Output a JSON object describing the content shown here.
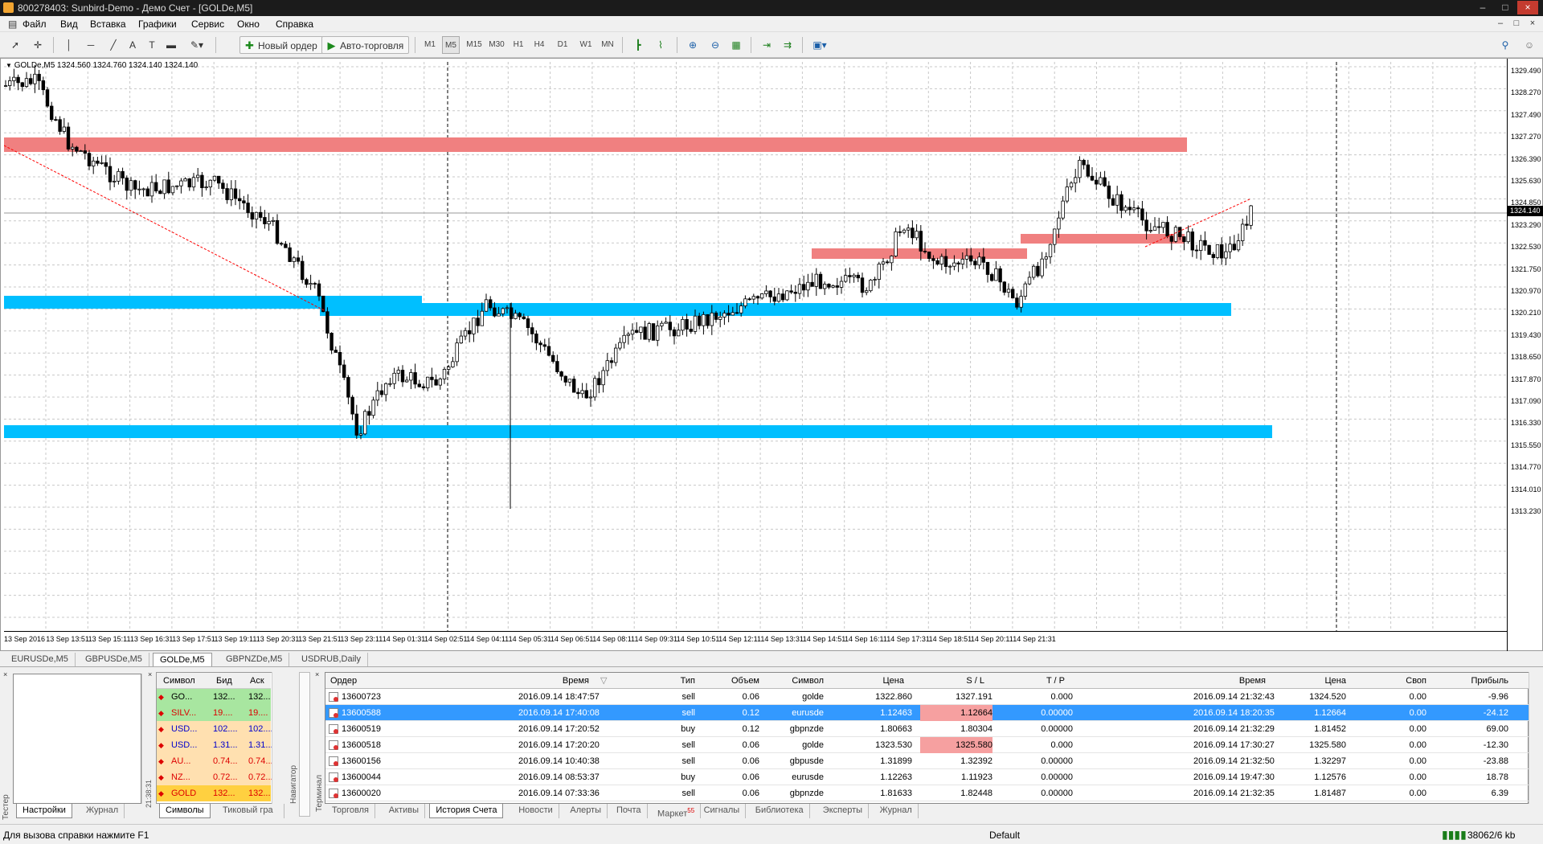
{
  "window": {
    "title": "800278403: Sunbird-Demo - Демо Счет - [GOLDe,M5]",
    "minimize": "–",
    "maximize": "□",
    "close": "×"
  },
  "menu": {
    "items": [
      "Файл",
      "Вид",
      "Вставка",
      "Графики",
      "Сервис",
      "Окно",
      "Справка"
    ],
    "mdi": [
      "–",
      "□",
      "×"
    ]
  },
  "toolbar": {
    "new_order": "Новый ордер",
    "auto_trading": "Авто-торговля",
    "timeframes": [
      "M1",
      "M5",
      "M15",
      "M30",
      "H1",
      "H4",
      "D1",
      "W1",
      "MN"
    ]
  },
  "chart": {
    "info": "GOLDe,M5  1324.560 1324.760 1324.140 1324.140",
    "current_price": "1324.140",
    "y_labels": [
      "1329.490",
      "1328.270",
      "1327.490",
      "1327.270",
      "1326.390",
      "1325.630",
      "1324.850",
      "1324.140",
      "1323.290",
      "1322.530",
      "1321.750",
      "1320.970",
      "1320.210",
      "1319.430",
      "1318.650",
      "1317.870",
      "1317.090",
      "1316.330",
      "1315.550",
      "1314.770",
      "1314.010",
      "1313.230"
    ],
    "x_labels": [
      "13 Sep 2016",
      "13 Sep 13:51",
      "13 Sep 15:11",
      "13 Sep 16:31",
      "13 Sep 17:51",
      "13 Sep 19:11",
      "13 Sep 20:31",
      "13 Sep 21:51",
      "13 Sep 23:11",
      "14 Sep 01:31",
      "14 Sep 02:51",
      "14 Sep 04:11",
      "14 Sep 05:31",
      "14 Sep 06:51",
      "14 Sep 08:11",
      "14 Sep 09:31",
      "14 Sep 10:51",
      "14 Sep 12:11",
      "14 Sep 13:31",
      "14 Sep 14:51",
      "14 Sep 16:11",
      "14 Sep 17:31",
      "14 Sep 18:51",
      "14 Sep 20:11",
      "14 Sep 21:31"
    ],
    "colors": {
      "resistance": "#f08080",
      "support": "#00bfff",
      "candles": "#000000",
      "trendline": "#ff0000"
    }
  },
  "chart_tabs": [
    "EURUSDe,M5",
    "GBPUSDe,M5",
    "GOLDe,M5",
    "GBPNZDe,M5",
    "USDRUB,Daily"
  ],
  "tester": {
    "label": "Тестер",
    "tabs": [
      "Настройки",
      "Журнал"
    ],
    "close": "×"
  },
  "market_watch": {
    "time": "21:38:31",
    "headers": [
      "Символ",
      "Бид",
      "Аск"
    ],
    "rows": [
      {
        "sym": "GO...",
        "bid": "132...",
        "ask": "132...",
        "color": "#a8e6a0",
        "fg": "#000"
      },
      {
        "sym": "SILV...",
        "bid": "19....",
        "ask": "19....",
        "color": "#a8e6a0",
        "fg": "#d00"
      },
      {
        "sym": "USD...",
        "bid": "102....",
        "ask": "102....",
        "color": "#ffe0b0",
        "fg": "#00c"
      },
      {
        "sym": "USD...",
        "bid": "1.31...",
        "ask": "1.31...",
        "color": "#ffe0b0",
        "fg": "#00c"
      },
      {
        "sym": "AU...",
        "bid": "0.74...",
        "ask": "0.74...",
        "color": "#ffe0b0",
        "fg": "#d00"
      },
      {
        "sym": "NZ...",
        "bid": "0.72...",
        "ask": "0.72...",
        "color": "#ffe0b0",
        "fg": "#d00"
      },
      {
        "sym": "GOLD",
        "bid": "132...",
        "ask": "132...",
        "color": "#ffd040",
        "fg": "#d00"
      }
    ],
    "tabs": [
      "Символы",
      "Тиковый гра"
    ],
    "close": "×"
  },
  "navigator": {
    "label": "Навигатор"
  },
  "terminal": {
    "label": "Терминал",
    "close": "×",
    "headers": [
      "Ордер",
      "Время",
      "Тип",
      "Объем",
      "Символ",
      "Цена",
      "S / L",
      "T / P",
      "Время",
      "Цена",
      "Своп",
      "Прибыль"
    ],
    "sort_mark": "▽",
    "rows": [
      {
        "order": "13600723",
        "time": "2016.09.14 18:47:57",
        "type": "sell",
        "vol": "0.06",
        "sym": "golde",
        "price": "1322.860",
        "sl": "1327.191",
        "tp": "0.000",
        "time2": "2016.09.14 21:32:43",
        "price2": "1324.520",
        "swap": "0.00",
        "profit": "-9.96",
        "sl_hit": false
      },
      {
        "order": "13600588",
        "time": "2016.09.14 17:40:08",
        "type": "sell",
        "vol": "0.12",
        "sym": "eurusde",
        "price": "1.12463",
        "sl": "1.12664",
        "tp": "0.00000",
        "time2": "2016.09.14 18:20:35",
        "price2": "1.12664",
        "swap": "0.00",
        "profit": "-24.12",
        "sl_hit": true
      },
      {
        "order": "13600519",
        "time": "2016.09.14 17:20:52",
        "type": "buy",
        "vol": "0.12",
        "sym": "gbpnzde",
        "price": "1.80663",
        "sl": "1.80304",
        "tp": "0.00000",
        "time2": "2016.09.14 21:32:29",
        "price2": "1.81452",
        "swap": "0.00",
        "profit": "69.00",
        "sl_hit": false
      },
      {
        "order": "13600518",
        "time": "2016.09.14 17:20:20",
        "type": "sell",
        "vol": "0.06",
        "sym": "golde",
        "price": "1323.530",
        "sl": "1325.580",
        "tp": "0.000",
        "time2": "2016.09.14 17:30:27",
        "price2": "1325.580",
        "swap": "0.00",
        "profit": "-12.30",
        "sl_hit": true
      },
      {
        "order": "13600156",
        "time": "2016.09.14 10:40:38",
        "type": "sell",
        "vol": "0.06",
        "sym": "gbpusde",
        "price": "1.31899",
        "sl": "1.32392",
        "tp": "0.00000",
        "time2": "2016.09.14 21:32:50",
        "price2": "1.32297",
        "swap": "0.00",
        "profit": "-23.88",
        "sl_hit": false
      },
      {
        "order": "13600044",
        "time": "2016.09.14 08:53:37",
        "type": "buy",
        "vol": "0.06",
        "sym": "eurusde",
        "price": "1.12263",
        "sl": "1.11923",
        "tp": "0.00000",
        "time2": "2016.09.14 19:47:30",
        "price2": "1.12576",
        "swap": "0.00",
        "profit": "18.78",
        "sl_hit": false
      },
      {
        "order": "13600020",
        "time": "2016.09.14 07:33:36",
        "type": "sell",
        "vol": "0.06",
        "sym": "gbpnzde",
        "price": "1.81633",
        "sl": "1.82448",
        "tp": "0.00000",
        "time2": "2016.09.14 21:32:35",
        "price2": "1.81487",
        "swap": "0.00",
        "profit": "6.39",
        "sl_hit": false
      }
    ],
    "tabs": [
      "Торговля",
      "Активы",
      "История Счета",
      "Новости",
      "Алерты",
      "Почта",
      "Маркет",
      "Сигналы",
      "Библиотека",
      "Эксперты",
      "Журнал"
    ],
    "market_badge": "55",
    "active_tab": "История Счета"
  },
  "status": {
    "help": "Для вызова справки нажмите F1",
    "profile": "Default",
    "traffic": "38062/6 kb"
  }
}
